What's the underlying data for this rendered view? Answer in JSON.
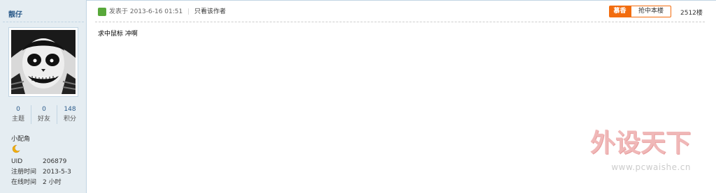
{
  "user": {
    "name": "靓仔",
    "stats": [
      {
        "value": "0",
        "label": "主题"
      },
      {
        "value": "0",
        "label": "好友"
      },
      {
        "value": "148",
        "label": "积分"
      }
    ],
    "rank": "小配角",
    "medal_icon": "moon-icon",
    "info": [
      {
        "key": "UID",
        "value": "206879"
      },
      {
        "key": "注册时间",
        "value": "2013-5-3"
      },
      {
        "key": "在线时间",
        "value": "2 小时"
      }
    ]
  },
  "post": {
    "meta_prefix": "发表于 2013-6-16 01:51",
    "separator": "|",
    "only_author": "只看该作者",
    "badge": "慕香",
    "grab_floor": "抢中本楼",
    "floor": "2512楼",
    "content": "求中鼠标 冲啊"
  },
  "watermark": {
    "title": "外设天下",
    "url": "www.pcwaishe.cn"
  },
  "colors": {
    "sidebar_bg": "#e5edf2",
    "link": "#2b5b8a",
    "accent_orange": "#f26c0e",
    "icon_green": "#58a83a"
  }
}
